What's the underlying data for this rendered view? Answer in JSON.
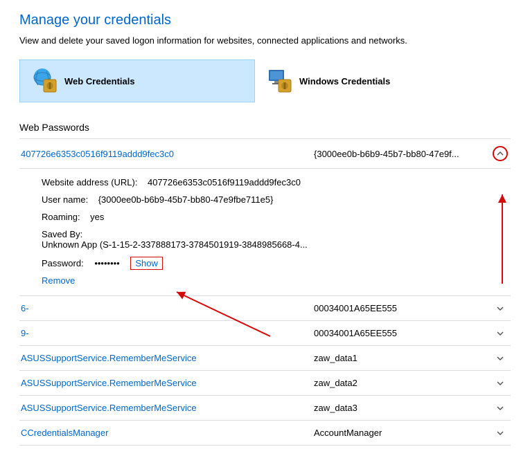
{
  "header": {
    "title": "Manage your credentials",
    "subtitle": "View and delete your saved logon information for websites, connected applications and networks."
  },
  "tabs": {
    "web": "Web Credentials",
    "windows": "Windows Credentials"
  },
  "section": {
    "webPasswords": "Web Passwords"
  },
  "expanded": {
    "name": "407726e6353c0516f9119addd9fec3c0",
    "user": "{3000ee0b-b6b9-45b7-bb80-47e9f...",
    "urlLabel": "Website address (URL):",
    "urlValue": "407726e6353c0516f9119addd9fec3c0",
    "userLabel": "User name:",
    "userValue": "{3000ee0b-b6b9-45b7-bb80-47e9fbe711e5}",
    "roamingLabel": "Roaming:",
    "roamingValue": "yes",
    "savedByLabel": "Saved By:",
    "savedByValue": "Unknown App (S-1-15-2-337888173-3784501919-3848985668-4...",
    "passwordLabel": "Password:",
    "passwordMask": "••••••••",
    "showLabel": "Show",
    "removeLabel": "Remove"
  },
  "rows": [
    {
      "name": "6-",
      "user": "00034001A65EE555"
    },
    {
      "name": "9-",
      "user": "00034001A65EE555"
    },
    {
      "name": "ASUSSupportService.RememberMeService",
      "user": "zaw_data1"
    },
    {
      "name": "ASUSSupportService.RememberMeService",
      "user": "zaw_data2"
    },
    {
      "name": "ASUSSupportService.RememberMeService",
      "user": "zaw_data3"
    },
    {
      "name": "CCredentialsManager",
      "user": "AccountManager"
    }
  ]
}
